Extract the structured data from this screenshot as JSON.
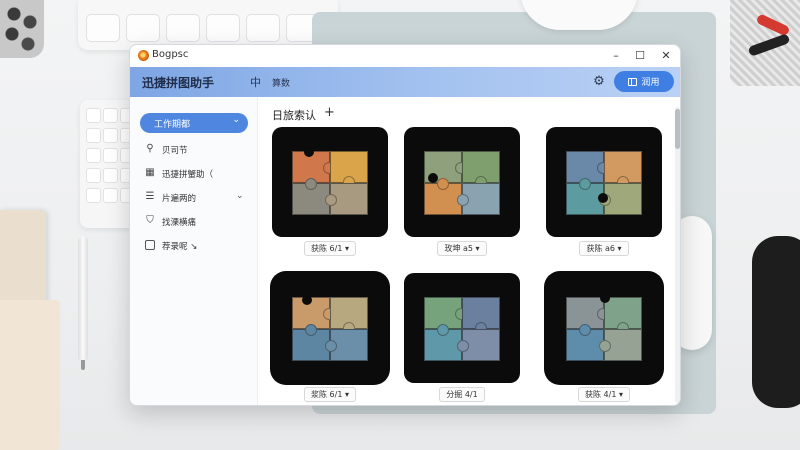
{
  "window": {
    "title": "Bogpsc",
    "min_label": "–",
    "max_label": "☐",
    "close_label": "✕"
  },
  "header": {
    "title": "迅捷拼图助手",
    "icon_glyph": "中",
    "label": "算数",
    "primary_button_label": "润用"
  },
  "sidebar": {
    "selector_label": "工作期都",
    "items": [
      {
        "label": "贝司节",
        "icon": "search-icon"
      },
      {
        "label": "迅捷拼蟹助（",
        "icon": "grid-icon"
      },
      {
        "label": "片遍两的",
        "icon": "list-icon"
      },
      {
        "label": "找溧横痛",
        "icon": "shield-icon"
      },
      {
        "label": "荐录呢 ↘",
        "icon": "toolbox-icon"
      }
    ]
  },
  "content": {
    "section_title": "日旅索认",
    "add_label": "+",
    "cards": [
      {
        "caption": "获陈 6/1 ▾",
        "colors": [
          "#d0784c",
          "#d9a44a",
          "#8c8a7e",
          "#a79a80"
        ]
      },
      {
        "caption": "玫坤 a5 ▾",
        "colors": [
          "#8fa07c",
          "#7fa06e",
          "#d29050",
          "#89a4b0"
        ]
      },
      {
        "caption": "获陈 a6 ▾",
        "colors": [
          "#6a88a8",
          "#d29a60",
          "#5c9ba0",
          "#9ea87a"
        ]
      },
      {
        "caption": "浆陈 6/1 ▾",
        "colors": [
          "#c99a6a",
          "#b8a880",
          "#5d86a2",
          "#6b8fa9"
        ]
      },
      {
        "caption": "分掘 4/1",
        "colors": [
          "#77a37c",
          "#6b7f9e",
          "#5f98a8",
          "#7f8ea8"
        ]
      },
      {
        "caption": "获陈 4/1 ▾",
        "colors": [
          "#8a9396",
          "#7fa28a",
          "#5e8cab",
          "#95a294"
        ]
      }
    ]
  },
  "colors": {
    "accent": "#3f7fe3",
    "header_gradient_start": "#7ea6e4",
    "sidebar_selected": "#4f86df"
  }
}
